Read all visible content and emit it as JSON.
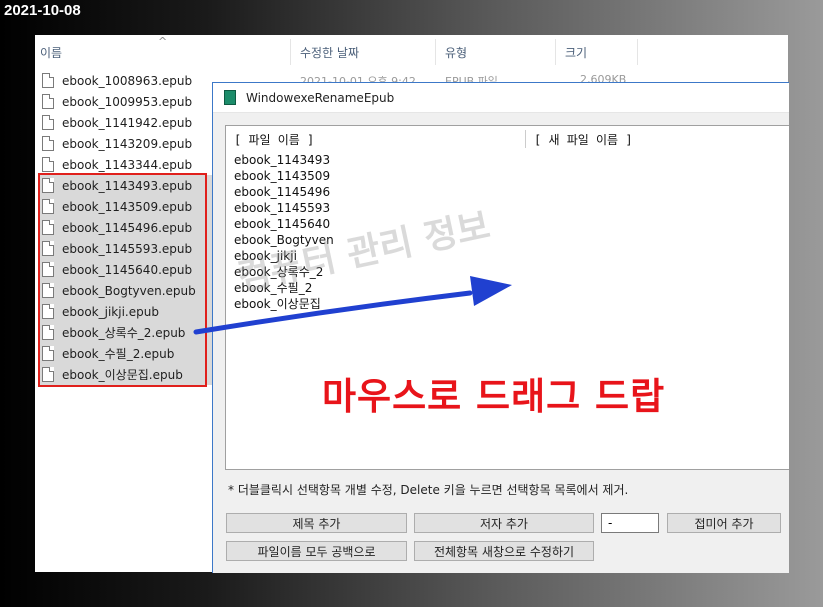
{
  "date_label": "2021-10-08",
  "explorer": {
    "columns": {
      "name": "이름",
      "modified": "수정한 날짜",
      "type": "유형",
      "size": "크기"
    },
    "partial_row": {
      "modified": "2021-10-01 오후 9:42",
      "type": "EPUB 파일",
      "size": "2,609KB"
    },
    "files": [
      "ebook_1008963.epub",
      "ebook_1009953.epub",
      "ebook_1141942.epub",
      "ebook_1143209.epub",
      "ebook_1143344.epub",
      "ebook_1143493.epub",
      "ebook_1143509.epub",
      "ebook_1145496.epub",
      "ebook_1145593.epub",
      "ebook_1145640.epub",
      "ebook_Bogtyven.epub",
      "ebook_jikji.epub",
      "ebook_상록수_2.epub",
      "ebook_수필_2.epub",
      "ebook_이상문집.epub"
    ]
  },
  "dialog": {
    "title": "WindowexeRenameEpub",
    "list_header_old": "[ 파일 이름 ]",
    "list_header_new": "[ 새 파일 이름 ]",
    "items": [
      "ebook_1143493",
      "ebook_1143509",
      "ebook_1145496",
      "ebook_1145593",
      "ebook_1145640",
      "ebook_Bogtyven",
      "ebook_jikji",
      "ebook_상록수_2",
      "ebook_수필_2",
      "ebook_이상문집"
    ],
    "hint": "* 더블클릭시 선택항목 개별 수정, Delete 키을 누르면 선택항목 목록에서 제거.",
    "buttons": {
      "add_title": "제목 추가",
      "add_author": "저자 추가",
      "separator_value": "-",
      "add_suffix": "접미어 추가",
      "spaces_all": "파일이름 모두 공백으로",
      "edit_all": "전체항목 새창으로 수정하기"
    }
  },
  "annotation": "마우스로 드래그 드랍",
  "watermark": "컴퓨터 관리 정보",
  "colors": {
    "annotation": "#e8141a",
    "arrow": "#2040d0",
    "selection_box": "#e0201c"
  }
}
